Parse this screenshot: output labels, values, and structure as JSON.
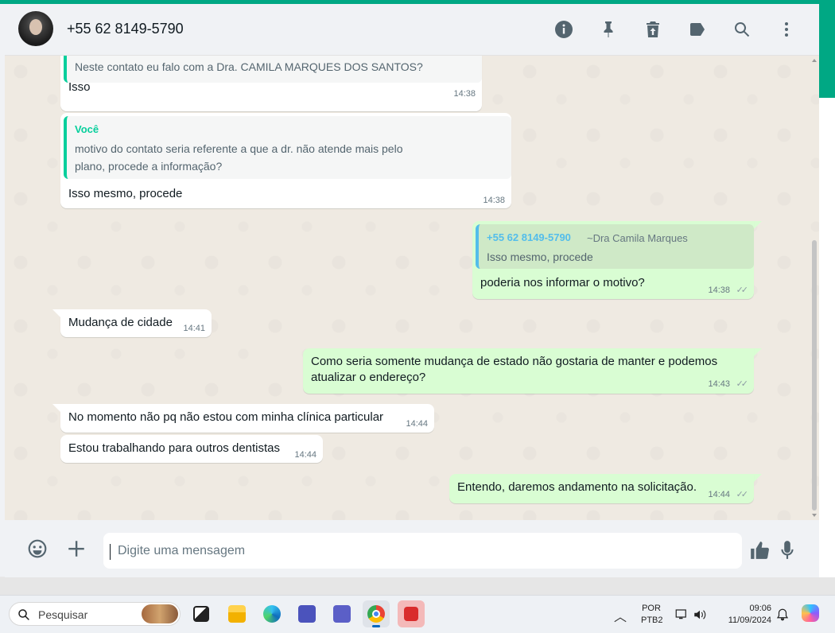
{
  "header": {
    "contact_name": "+55 62 8149-5790",
    "icons": [
      "info-icon",
      "pin-icon",
      "delete-icon",
      "label-icon",
      "search-icon",
      "menu-dots-icon"
    ]
  },
  "messages": {
    "m1": {
      "quote_text": "Neste contato eu falo com a Dra. CAMILA MARQUES DOS SANTOS?",
      "text": "Isso",
      "time": "14:38"
    },
    "m2": {
      "quote_author": "Você",
      "quote_line1": "motivo do contato seria referente a que a dr. não atende mais pelo",
      "quote_line2": "plano, procede a informação?",
      "text": "Isso mesmo, procede",
      "time": "14:38"
    },
    "m3": {
      "quote_author": "+55 62 8149-5790",
      "quote_alias": "~Dra Camila Marques",
      "quote_text": "Isso mesmo, procede",
      "text": "poderia nos informar o motivo?",
      "time": "14:38",
      "ticks": "✓✓"
    },
    "m4": {
      "text": "Mudança de cidade",
      "time": "14:41"
    },
    "m5": {
      "line1": "Como seria somente mudança de estado não gostaria de manter e podemos",
      "line2": "atualizar o endereço?",
      "time": "14:43",
      "ticks": "✓✓"
    },
    "m6": {
      "text": "No momento não pq não estou com minha clínica particular",
      "time": "14:44"
    },
    "m7": {
      "text": "Estou trabalhando para outros dentistas",
      "time": "14:44"
    },
    "m8": {
      "text": "Entendo, daremos andamento na solicitação.",
      "time": "14:44",
      "ticks": "✓✓"
    }
  },
  "composer": {
    "placeholder": "Digite uma mensagem"
  },
  "taskbar": {
    "search_label": "Pesquisar",
    "lang_top": "POR",
    "lang_bottom": "PTB2",
    "time": "09:06",
    "date": "11/09/2024"
  },
  "colors": {
    "accent": "#00a884",
    "outgoing_bubble": "#d9fdd3",
    "incoming_bubble": "#ffffff",
    "chat_background": "#efeae2"
  }
}
